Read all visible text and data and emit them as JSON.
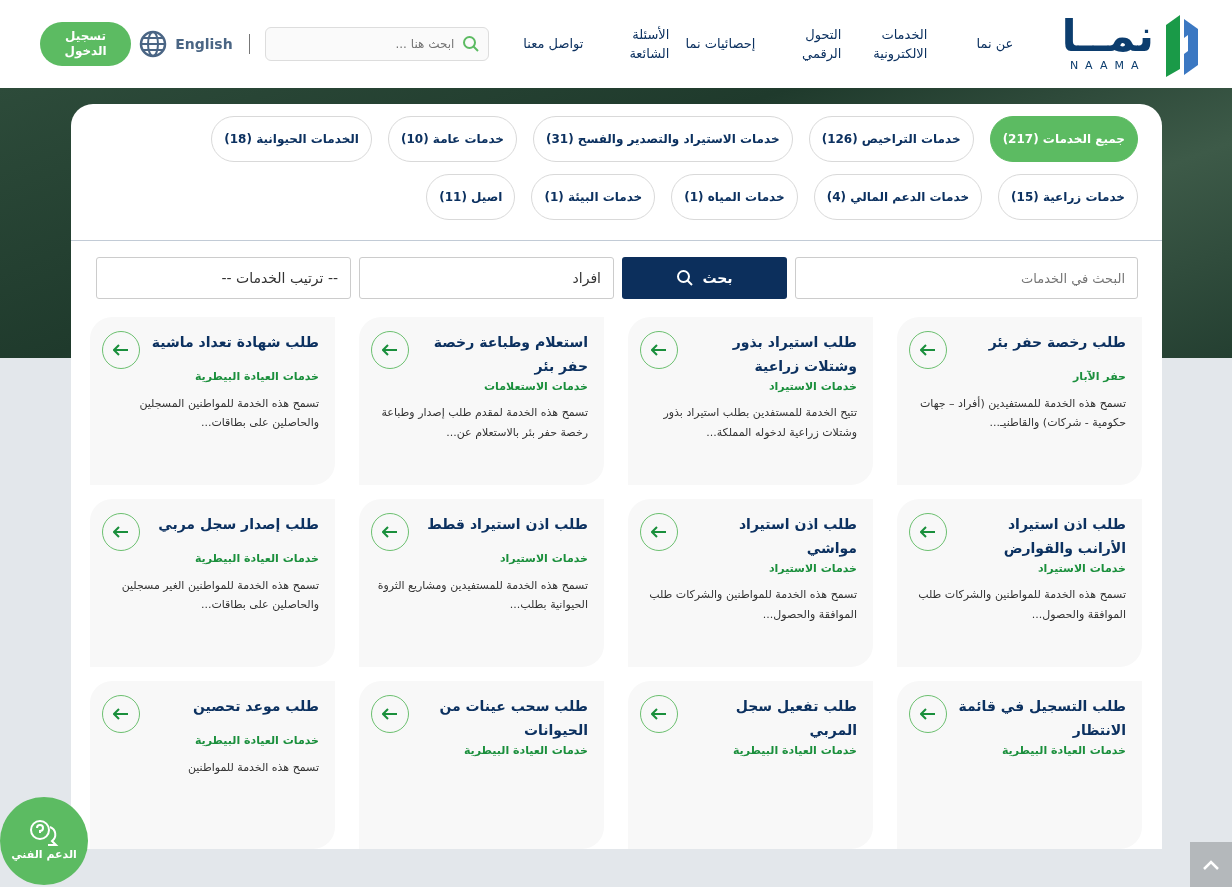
{
  "header": {
    "logo": {
      "name": "نمــا",
      "latin": "NAAMA"
    },
    "nav": [
      "عن نما",
      "الخدمات الالكترونية",
      "التحول الرقمي",
      "إحصائيات نما",
      "الأسئلة الشائعة",
      "تواصل معنا"
    ],
    "search": {
      "placeholder": "ابحث هنا ..."
    },
    "language": "English",
    "login": "تسجيل الدخول"
  },
  "categories": [
    {
      "label": "جميع الخدمات (217)",
      "selected": true
    },
    {
      "label": "خدمات التراخيص (126)",
      "selected": false
    },
    {
      "label": "خدمات الاستيراد والتصدير والفسح (31)",
      "selected": false
    },
    {
      "label": "خدمات عامة (10)",
      "selected": false
    },
    {
      "label": "الخدمات الحيوانية (18)",
      "selected": false
    },
    {
      "label": "خدمات زراعية (15)",
      "selected": false
    },
    {
      "label": "خدمات الدعم المالي (4)",
      "selected": false
    },
    {
      "label": "خدمات المياه (1)",
      "selected": false
    },
    {
      "label": "خدمات البيئة (1)",
      "selected": false
    },
    {
      "label": "اصيل (11)",
      "selected": false
    }
  ],
  "filters": {
    "search": {
      "placeholder": "البحث في الخدمات"
    },
    "search_button": "بحث",
    "audience": "افراد",
    "sort": "-- ترتيب الخدمات --"
  },
  "services": [
    {
      "title": "طلب رخصة حفر بئر",
      "category": "حفر الآبار",
      "description": "تسمح هذه الخدمة للمستفيدين (أفراد – جهات حكومية - شركات) والقاطنيـ..."
    },
    {
      "title": "طلب استيراد بذور وشتلات زراعية",
      "category": "خدمات الاستيراد",
      "description": "تتيح الخدمة للمستفدين بطلب استيراد بذور وشتلات زراعية لدخوله المملكة..."
    },
    {
      "title": "استعلام وطباعة رخصة حفر بئر",
      "category": "خدمات الاستعلامات",
      "description": "تسمح هذه الخدمة لمقدم طلب إصدار وطباعة رخصة حفر بئر بالاستعلام عن..."
    },
    {
      "title": "طلب شهادة تعداد ماشية",
      "category": "خدمات العيادة البيطرية",
      "description": "تسمح هذه الخدمة للمواطنين المسجلين والحاصلين على بطاقات..."
    },
    {
      "title": "طلب اذن استيراد الأرانب والقوارض",
      "category": "خدمات الاستيراد",
      "description": "تسمح هذه الخدمة للمواطنين والشركات طلب الموافقة والحصول..."
    },
    {
      "title": "طلب اذن استيراد مواشي",
      "category": "خدمات الاستيراد",
      "description": "تسمح هذه الخدمة للمواطنين والشركات طلب الموافقة والحصول..."
    },
    {
      "title": "طلب اذن استيراد قطط",
      "category": "خدمات الاستيراد",
      "description": "تسمح هذه الخدمة للمستفيدين ومشاريع الثروة الحيوانية بطلب..."
    },
    {
      "title": "طلب إصدار سجل مربي",
      "category": "خدمات العيادة البيطرية",
      "description": "تسمح هذه الخدمة للمواطنين الغير مسجلين والحاصلين على بطاقات..."
    },
    {
      "title": "طلب التسجيل في قائمة الانتظار",
      "category": "خدمات العيادة البيطرية"
    },
    {
      "title": "طلب تفعيل سجل المربي",
      "category": "خدمات العيادة البيطرية"
    },
    {
      "title": "طلب سحب عينات من الحيوانات",
      "category": "خدمات العيادة البيطرية"
    },
    {
      "title": "طلب موعد تحصين",
      "category": "خدمات العيادة البيطرية",
      "description": "تسمح هذه الخدمة للمواطنين"
    }
  ],
  "support_button": "الدعم الفني"
}
